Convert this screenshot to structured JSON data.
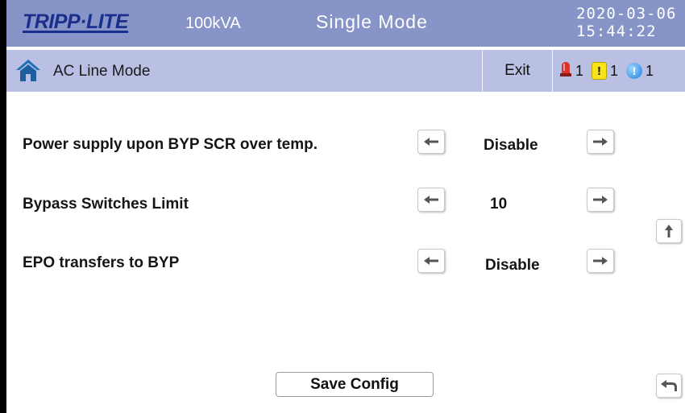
{
  "header": {
    "brand": "TRIPP·LITE",
    "rating": "100kVA",
    "mode": "Single Mode",
    "date": "2020-03-06",
    "time": "15:44:22"
  },
  "subheader": {
    "title": "AC Line Mode",
    "exit_label": "Exit",
    "alarms": [
      {
        "icon": "siren-icon",
        "count": "1"
      },
      {
        "icon": "warning-icon",
        "symbol": "!",
        "count": "1"
      },
      {
        "icon": "info-icon",
        "symbol": "!",
        "count": "1"
      }
    ]
  },
  "settings": [
    {
      "label": "Power supply upon BYP SCR over temp.",
      "value": "Disable"
    },
    {
      "label": "Bypass  Switches Limit",
      "value": "10"
    },
    {
      "label": "EPO transfers to BYP",
      "value": "Disable"
    }
  ],
  "footer": {
    "save_label": "Save Config"
  },
  "colors": {
    "topbar": "#8694c7",
    "subbar": "#b9c0e4",
    "brand": "#1a2f8c"
  }
}
